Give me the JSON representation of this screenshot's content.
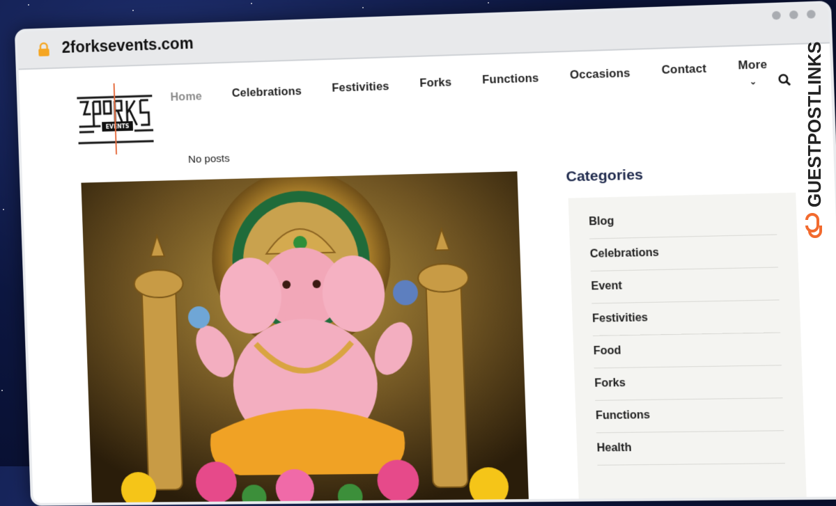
{
  "browser": {
    "url": "2forksevents.com",
    "lock_icon": "lock-icon"
  },
  "logo": {
    "text": "2FORKS",
    "sub": "EVENTS"
  },
  "nav": {
    "items": [
      {
        "label": "Home",
        "active": true
      },
      {
        "label": "Celebrations"
      },
      {
        "label": "Festivities"
      },
      {
        "label": "Forks"
      },
      {
        "label": "Functions"
      },
      {
        "label": "Occasions"
      },
      {
        "label": "Contact"
      }
    ],
    "more": "More",
    "search_icon": "search-icon"
  },
  "main": {
    "no_posts": "No posts"
  },
  "sidebar": {
    "title": "Categories",
    "categories": [
      "Blog",
      "Celebrations",
      "Event",
      "Festivities",
      "Food",
      "Forks",
      "Functions",
      "Health"
    ]
  },
  "watermark": {
    "text": "GUESTPOSTLINKS"
  },
  "colors": {
    "accent": "#f26a2e",
    "heading": "#1f2a4d",
    "browser_bar": "#e8e9eb"
  }
}
